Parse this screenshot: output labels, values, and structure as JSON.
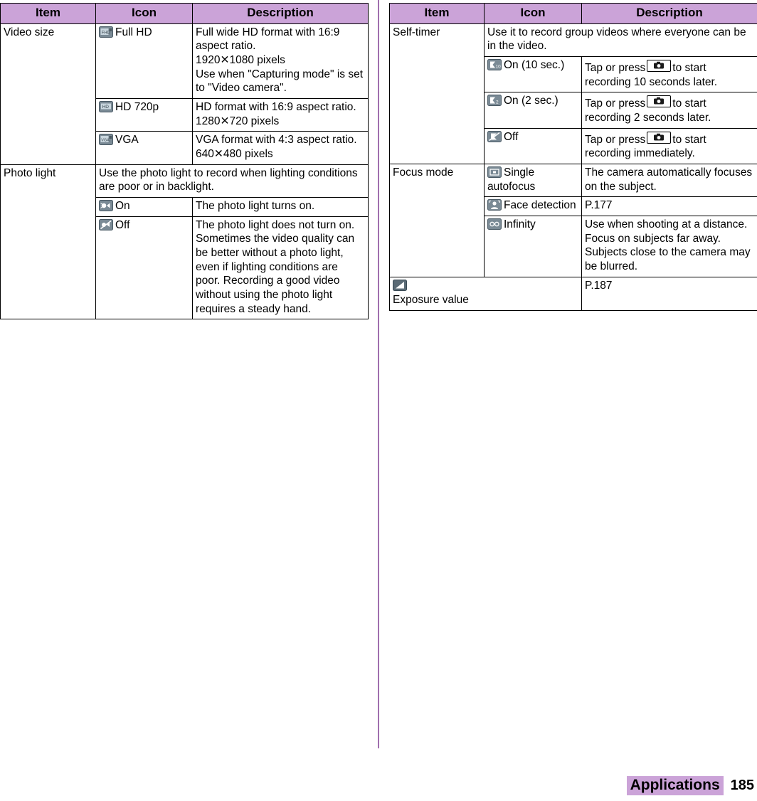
{
  "columns": {
    "left": {
      "headers": [
        "Item",
        "Icon",
        "Description"
      ],
      "rows": [
        {
          "item": "Video size",
          "icon_label": "Full HD",
          "icon": "fullhd-icon",
          "description": "Full wide HD format with 16:9 aspect ratio.\n1920✕1080 pixels\nUse when \"Capturing mode\" is set to \"Video camera\"."
        },
        {
          "item": "",
          "icon_label": "HD 720p",
          "icon": "hd720p-icon",
          "description": "HD format with 16:9 aspect ratio.\n1280✕720 pixels"
        },
        {
          "item": "",
          "icon_label": "VGA",
          "icon": "vga-icon",
          "description": "VGA format with 4:3 aspect ratio.\n640✕480 pixels"
        },
        {
          "item": "Photo light",
          "icon_label": "",
          "icon": "",
          "description": "Use the photo light to record when lighting conditions are poor or in backlight.",
          "span": "full"
        },
        {
          "item": "",
          "icon_label": "On",
          "icon": "photolight-on-icon",
          "description": "The photo light turns on."
        },
        {
          "item": "",
          "icon_label": "Off",
          "icon": "photolight-off-icon",
          "description": "The photo light does not turn on. Sometimes the video quality can be better without a photo light, even if lighting conditions are poor. Recording a good video without using the photo light requires a steady hand."
        }
      ]
    },
    "right": {
      "headers": [
        "Item",
        "Icon",
        "Description"
      ],
      "rows": [
        {
          "item": "Self-timer",
          "icon_label": "",
          "icon": "",
          "description": "Use it to record group videos where everyone can be in the video.",
          "span": "merged-icon-desc"
        },
        {
          "item": "",
          "icon_label": "On (10 sec.)",
          "icon": "selftimer-10-icon",
          "description_parts": [
            "Tap or press",
            "KEY",
            "to start recording 10 seconds later."
          ]
        },
        {
          "item": "",
          "icon_label": "On (2 sec.)",
          "icon": "selftimer-2-icon",
          "description_parts": [
            "Tap or press",
            "KEY",
            "to start recording 2 seconds later."
          ]
        },
        {
          "item": "",
          "icon_label": "Off",
          "icon": "selftimer-off-icon",
          "description_parts": [
            "Tap or press",
            "KEY",
            "to start recording immediately."
          ]
        },
        {
          "item": "Focus mode",
          "icon_label": "Single autofocus",
          "icon": "single-autofocus-icon",
          "description": "The camera automatically focuses on the subject."
        },
        {
          "item": "",
          "icon_label": "Face detection",
          "icon": "face-detection-icon",
          "description": "P.177"
        },
        {
          "item": "",
          "icon_label": "Infinity",
          "icon": "infinity-icon",
          "description": "Use when shooting at a distance. Focus on subjects far away. Subjects close to the camera may be blurred."
        },
        {
          "item": "Exposure value",
          "icon_label": "",
          "icon": "exposure-icon",
          "description": "P.187",
          "span": "item-icon-inline"
        }
      ]
    }
  },
  "footer": {
    "section": "Applications",
    "page": "185"
  },
  "colors": {
    "header_bg": "#cba3d8",
    "divider": "#a06fae",
    "border": "#000000"
  }
}
